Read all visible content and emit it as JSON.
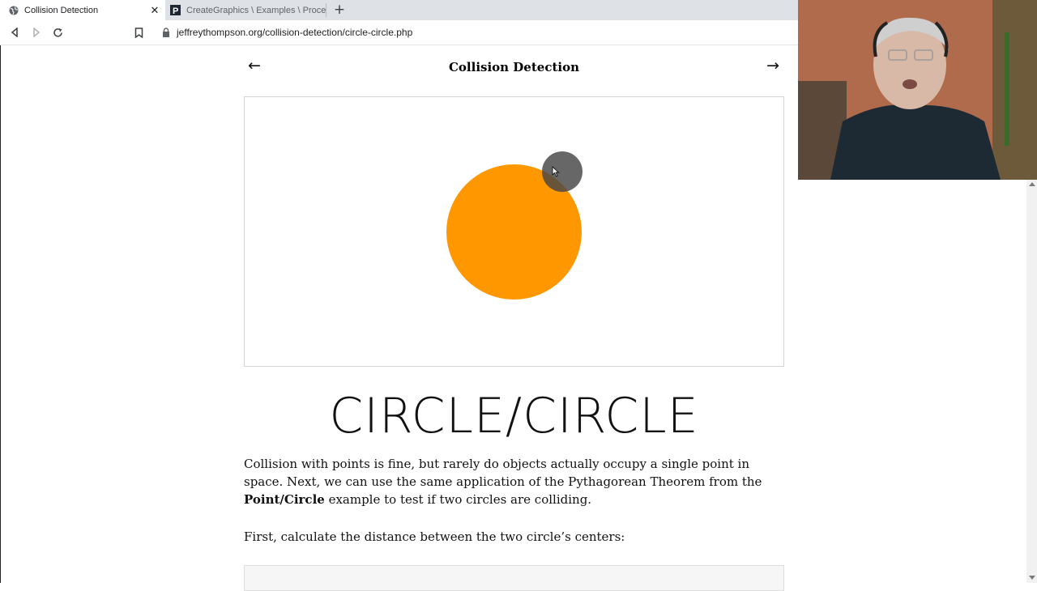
{
  "browser": {
    "tabs": [
      {
        "title": "Collision Detection",
        "active": true,
        "favicon": "globe-icon"
      },
      {
        "title": "CreateGraphics \\ Examples \\ Processing",
        "active": false,
        "favicon": "processing-p-icon"
      }
    ],
    "close_label": "✕",
    "new_tab_label": "+",
    "url": "jeffreythompson.org/collision-detection/circle-circle.php"
  },
  "page": {
    "site_title": "Collision Detection",
    "prev_arrow": "←",
    "next_arrow": "→",
    "heading": "CIRCLE/CIRCLE",
    "paragraph1": {
      "before": "Collision with points is fine, but rarely do objects actually occupy a single point in space. Next, we can use the same application of the Pythagorean Theorem from the ",
      "bold": "Point/Circle",
      "after": " example to test if two circles are colliding."
    },
    "paragraph2": "First, calculate the distance between the two circle’s centers:"
  },
  "colors": {
    "circle": "#ff9800",
    "mouse_circle": "#464646"
  }
}
